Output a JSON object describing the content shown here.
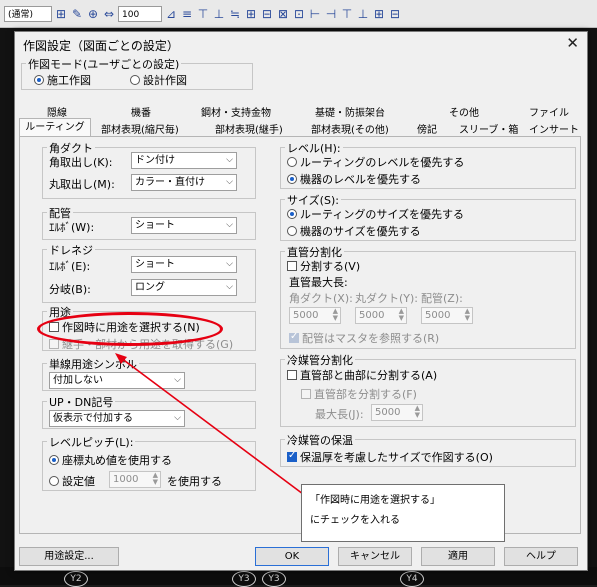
{
  "background": {
    "combo_text": "(通常)",
    "combo2_text": "100",
    "bottom_marks": [
      "Y2",
      "Y3",
      "Y3",
      "Y4"
    ]
  },
  "dialog": {
    "title": "作図設定（図面ごとの設定）",
    "mode_group": {
      "label": "作図モード(ユーザごとの設定)",
      "options": [
        "施工作図",
        "設計作図"
      ],
      "selected": "施工作図"
    },
    "tabs_row1": [
      "隠線",
      "機番",
      "鋼材・支持金物",
      "基礎・防振架台",
      "その他",
      "ファイル"
    ],
    "tabs_row2": [
      "ルーティング",
      "部材表現(縮尺毎)",
      "部材表現(継手)",
      "部材表現(その他)",
      "傍記",
      "スリーブ・箱",
      "インサート"
    ],
    "active_tab": "ルーティング",
    "left": {
      "duct": {
        "label": "角ダクト",
        "corner_label": "角取出し(K):",
        "corner_value": "ドン付け",
        "round_label": "丸取出し(M):",
        "round_value": "カラー・直付け"
      },
      "piping": {
        "label": "配管",
        "elbow_label": "ｴﾙﾎﾞ(W):",
        "elbow_value": "ショート"
      },
      "drain": {
        "label": "ドレネジ",
        "elbow_label": "ｴﾙﾎﾞ(E):",
        "elbow_value": "ショート",
        "branch_label": "分岐(B):",
        "branch_value": "ロング"
      },
      "usage": {
        "label": "用途",
        "select_on_draw": "作図時に用途を選択する(N)",
        "take_from_member": "継手・部材から用途を取得する(G)"
      },
      "single_line": {
        "label": "単線用途シンボル",
        "value": "付加しない"
      },
      "up_dn": {
        "label": "UP・DN記号",
        "value": "仮表示で付加する"
      },
      "level_pitch": {
        "label": "レベルピッチ(L):",
        "opt1": "座標丸め値を使用する",
        "opt2": "設定値",
        "value": "1000",
        "suffix": "を使用する"
      }
    },
    "right": {
      "level": {
        "label": "レベル(H):",
        "opt1": "ルーティングのレベルを優先する",
        "opt2": "機器のレベルを優先する",
        "selected": "機器のレベルを優先する"
      },
      "size": {
        "label": "サイズ(S):",
        "opt1": "ルーティングのサイズを優先する",
        "opt2": "機器のサイズを優先する",
        "selected": "ルーティングのサイズを優先する"
      },
      "straight_split": {
        "label": "直管分割化",
        "split": "分割する(V)",
        "max_length_label": "直管最大長:",
        "sq_duct_label": "角ダクト(X):",
        "rd_duct_label": "丸ダクト(Y):",
        "pipe_label": "配管(Z):",
        "sq_duct_value": "5000",
        "rd_duct_value": "5000",
        "pipe_value": "5000",
        "mask_ref": "配管はマスタを参照する(R)"
      },
      "coolant_split": {
        "label": "冷媒管分割化",
        "split_straight_bend": "直管部と曲部に分割する(A)",
        "split_straight": "直管部を分割する(F)",
        "max_length_label": "最大長(J):",
        "max_length_value": "5000"
      },
      "coolant_insulation": {
        "label": "冷媒管の保温",
        "consider_thickness": "保温厚を考慮したサイズで作図する(O)"
      }
    },
    "buttons": {
      "usage_settings": "用途設定...",
      "ok": "OK",
      "cancel": "キャンセル",
      "apply": "適用",
      "help": "ヘルプ"
    }
  },
  "annotation": {
    "line1": "「作図時に用途を選択する」",
    "line2": "にチェックを入れる",
    "color": "#e60012"
  }
}
